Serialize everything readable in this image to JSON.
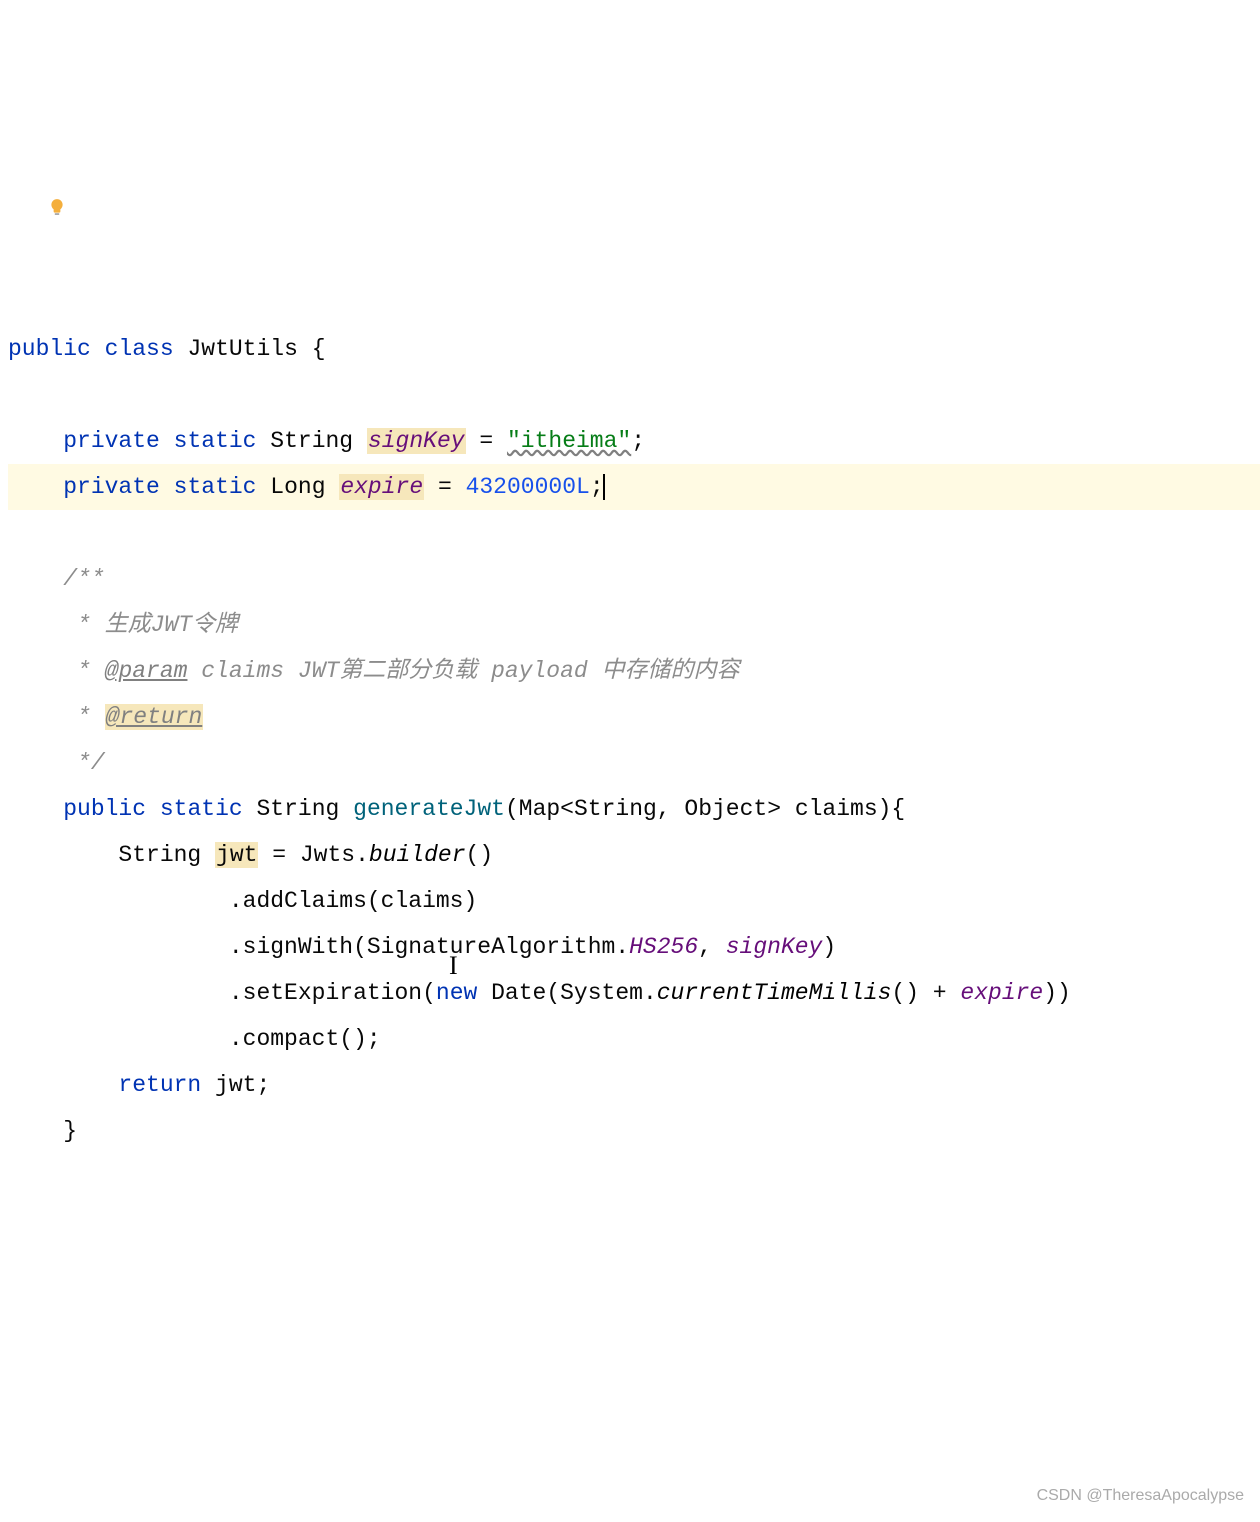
{
  "code": {
    "line1": {
      "kw1": "public",
      "kw2": "class",
      "cls": "JwtUtils",
      "brace": " {"
    },
    "line3": {
      "kw1": "private",
      "kw2": "static",
      "type": "String",
      "field": "signKey",
      "eq": " = ",
      "str": "\"itheima\"",
      "semi": ";"
    },
    "line4": {
      "kw1": "private",
      "kw2": "static",
      "type": "Long",
      "field": "expire",
      "eq": " = ",
      "num": "43200000L",
      "semi": ";"
    },
    "doc": {
      "open": "/**",
      "l1": " * 生成JWT令牌",
      "l2_star": " * ",
      "l2_param": "@param",
      "l2_rest": " claims JWT第二部分负载 payload 中存储的内容",
      "l3_star": " * ",
      "l3_return": "@return",
      "close": " */"
    },
    "method": {
      "kw1": "public",
      "kw2": "static",
      "ret": "String",
      "name": "generateJwt",
      "params_open": "(Map<String, Object> claims){",
      "l1_a": "String ",
      "l1_jwt": "jwt",
      "l1_b": " = Jwts.",
      "l1_builder": "builder",
      "l1_c": "()",
      "l2": ".addClaims(claims)",
      "l3_a": ".signWith(SignatureAlgorithm.",
      "l3_hs": "HS256",
      "l3_b": ", ",
      "l3_sk": "signKey",
      "l3_c": ")",
      "l4_a": ".setExpiration(",
      "l4_new": "new",
      "l4_b": " Date(System.",
      "l4_ctm": "currentTimeMillis",
      "l4_c": "() + ",
      "l4_exp": "expire",
      "l4_d": "))",
      "l5": ".compact();",
      "ret_a": "return",
      "ret_b": " jwt;",
      "close": "}"
    }
  },
  "watermark": "CSDN @TheresaApocalypse"
}
